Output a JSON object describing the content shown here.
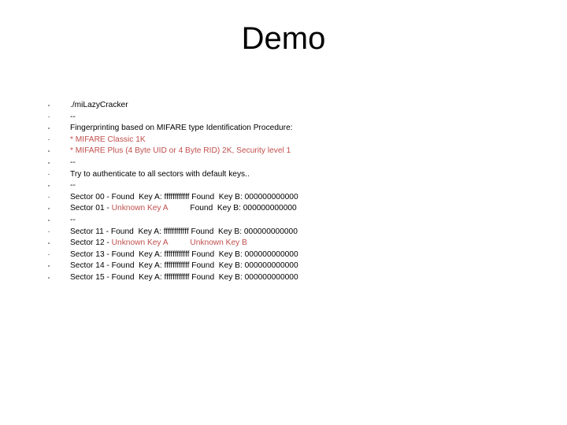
{
  "slide": {
    "title": "Demo",
    "accent_red": "#C0504D",
    "text_color": "#000000",
    "background": "#ffffff",
    "bullet_color": "#8a8a8a"
  },
  "lines": [
    {
      "id": "cmd",
      "segments": [
        {
          "text": "./miLazyCracker",
          "color": "black"
        }
      ]
    },
    {
      "id": "sep1",
      "segments": [
        {
          "text": "--",
          "color": "black"
        }
      ]
    },
    {
      "id": "fingerprint",
      "segments": [
        {
          "text": "Fingerprinting based on MIFARE type Identification Procedure:",
          "color": "black"
        }
      ]
    },
    {
      "id": "classic",
      "segments": [
        {
          "text": "* MIFARE Classic 1K",
          "color": "red"
        }
      ]
    },
    {
      "id": "plus",
      "segments": [
        {
          "text": "* MIFARE Plus (4 Byte UID or 4 Byte RID) 2K, Security level 1",
          "color": "red"
        }
      ]
    },
    {
      "id": "sep2",
      "segments": [
        {
          "text": "--",
          "color": "black"
        }
      ]
    },
    {
      "id": "tryauth",
      "segments": [
        {
          "text": "Try to authenticate to all sectors with default keys..",
          "color": "black"
        }
      ]
    },
    {
      "id": "sep3",
      "segments": [
        {
          "text": "--",
          "color": "black"
        }
      ]
    },
    {
      "id": "sector00",
      "segments": [
        {
          "text": "Sector 00 - Found  Key A: ffffffffffff Found  Key B: 000000000000",
          "color": "black"
        }
      ]
    },
    {
      "id": "sector01",
      "segments": [
        {
          "text": "Sector 01 - ",
          "color": "black"
        },
        {
          "text": "Unknown Key A",
          "color": "red"
        },
        {
          "text": "          ",
          "color": "black"
        },
        {
          "text": "Found  Key B: 000000000000",
          "color": "black"
        }
      ]
    },
    {
      "id": "sep4",
      "segments": [
        {
          "text": "--",
          "color": "black"
        }
      ]
    },
    {
      "id": "sector11",
      "segments": [
        {
          "text": "Sector 11 - Found  Key A: ffffffffffff Found  Key B: 000000000000",
          "color": "black"
        }
      ]
    },
    {
      "id": "sector12",
      "segments": [
        {
          "text": "Sector 12 - ",
          "color": "black"
        },
        {
          "text": "Unknown Key A",
          "color": "red"
        },
        {
          "text": "          ",
          "color": "black"
        },
        {
          "text": "Unknown Key B",
          "color": "red"
        }
      ]
    },
    {
      "id": "sector13",
      "segments": [
        {
          "text": "Sector 13 - Found  Key A: ffffffffffff Found  Key B: 000000000000",
          "color": "black"
        }
      ]
    },
    {
      "id": "sector14",
      "segments": [
        {
          "text": "Sector 14 - Found  Key A: ffffffffffff Found  Key B: 000000000000",
          "color": "black"
        }
      ]
    },
    {
      "id": "sector15",
      "segments": [
        {
          "text": "Sector 15 - Found  Key A: ffffffffffff Found  Key B: 000000000000",
          "color": "black"
        }
      ]
    }
  ]
}
